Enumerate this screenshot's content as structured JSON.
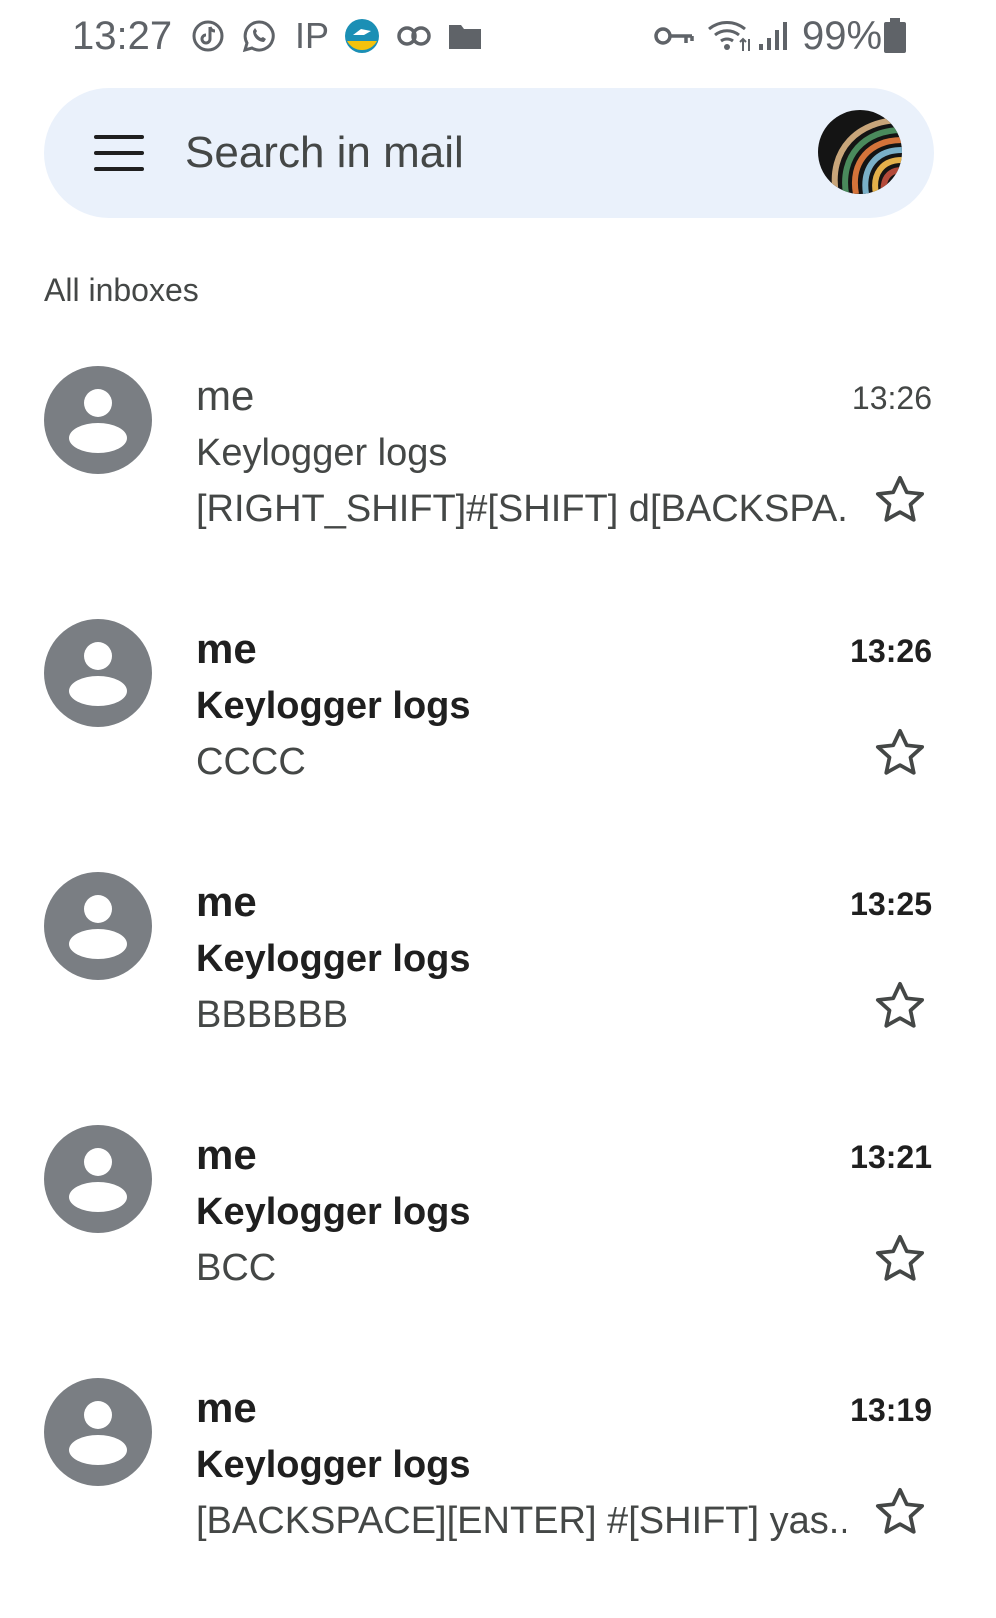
{
  "status_bar": {
    "time": "13:27",
    "ip_label": "IP",
    "battery": "99%",
    "icons": [
      "tiktok-icon",
      "whatsapp-icon",
      "ip-icon",
      "app-icon",
      "link-icon",
      "folder-icon",
      "vpn-key-icon",
      "wifi-icon",
      "signal-icon",
      "battery-icon"
    ]
  },
  "search": {
    "placeholder": "Search in mail"
  },
  "section": {
    "label": "All inboxes"
  },
  "mails": [
    {
      "sender": "me",
      "subject": "Keylogger logs",
      "snippet": "[RIGHT_SHIFT]#[SHIFT] d[BACKSPA...",
      "time": "13:26",
      "unread": false
    },
    {
      "sender": "me",
      "subject": "Keylogger logs",
      "snippet": "CCCC",
      "time": "13:26",
      "unread": true
    },
    {
      "sender": "me",
      "subject": "Keylogger logs",
      "snippet": "BBBBBB",
      "time": "13:25",
      "unread": true
    },
    {
      "sender": "me",
      "subject": "Keylogger logs",
      "snippet": "BCC",
      "time": "13:21",
      "unread": true
    },
    {
      "sender": "me",
      "subject": "Keylogger logs",
      "snippet": "[BACKSPACE][ENTER] #[SHIFT] yas...",
      "time": "13:19",
      "unread": true
    }
  ],
  "colors": {
    "search_bg": "#eaf1fb",
    "avatar_gray": "#7a7e83",
    "text_muted": "#444746",
    "text_strong": "#1f1f1f"
  }
}
